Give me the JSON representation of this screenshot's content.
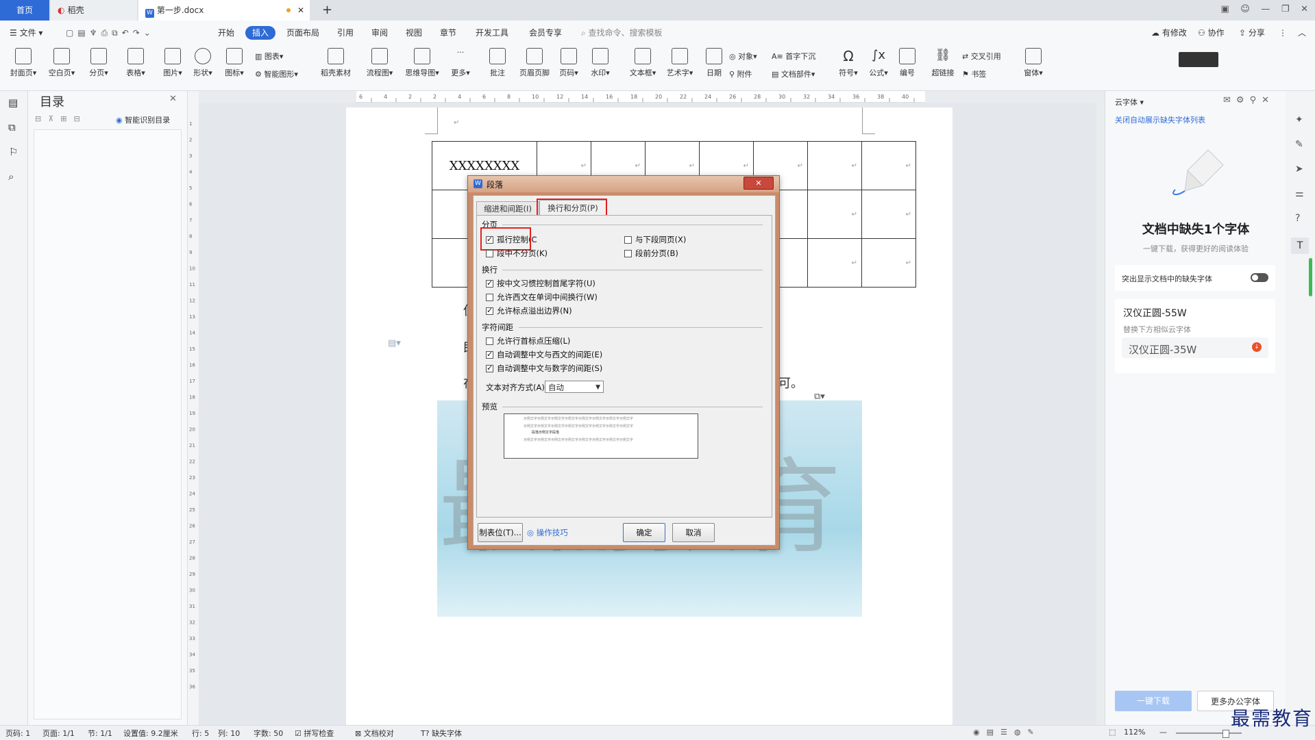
{
  "titlebar": {
    "tab_home": "首页",
    "tab_daoke": "稻壳",
    "tab_doc": "第一步.docx",
    "new_tab": "+"
  },
  "menubar": {
    "file": "文件",
    "items": [
      "开始",
      "插入",
      "页面布局",
      "引用",
      "审阅",
      "视图",
      "章节",
      "开发工具",
      "会员专享"
    ],
    "search_placeholder": "查找命令、搜索模板",
    "modify": "有修改",
    "collaborate": "协作",
    "share": "分享"
  },
  "ribbon": {
    "cover": "封面页",
    "blank": "空白页",
    "pagebreak": "分页",
    "table": "表格",
    "picture": "图片",
    "shape": "形状",
    "icon": "图标",
    "chart": "图表",
    "smartart": "智能图形",
    "daoke_material": "稻壳素材",
    "flowchart": "流程图",
    "mindmap": "思维导图",
    "more": "更多",
    "comment": "批注",
    "header_footer": "页眉页脚",
    "page_number": "页码",
    "watermark": "水印",
    "textbox": "文本框",
    "wordart": "艺术字",
    "date": "日期",
    "object": "对象",
    "attachment": "附件",
    "dropcap": "首字下沉",
    "docpart": "文档部件",
    "symbol": "符号",
    "formula": "公式",
    "numbering": "编号",
    "hyperlink": "超链接",
    "crossref": "交叉引用",
    "bookmark": "书签",
    "window": "窗体"
  },
  "navpanel": {
    "title": "目录",
    "smart_toc": "智能识别目录"
  },
  "document": {
    "table_first_cell": "XXXXXXXX",
    "para_mark": "↵",
    "text_fragment_1": "但",
    "text_fragment_2": "即",
    "text_fragment_3": "在",
    "text_fragment_end": "可。",
    "watermark_text": "最需教育"
  },
  "ruler": {
    "h_ticks": [
      "6",
      "4",
      "2",
      "2",
      "4",
      "6",
      "8",
      "10",
      "12",
      "14",
      "16",
      "18",
      "20",
      "22",
      "24",
      "26",
      "28",
      "30",
      "32",
      "34",
      "36",
      "38",
      "40"
    ],
    "v_ticks": [
      "1",
      "2",
      "3",
      "4",
      "5",
      "6",
      "7",
      "8",
      "9",
      "10",
      "11",
      "12",
      "13",
      "14",
      "15",
      "16",
      "17",
      "18",
      "19",
      "20",
      "21",
      "22",
      "23",
      "24",
      "25",
      "26",
      "27",
      "28",
      "29",
      "30",
      "31",
      "32",
      "33",
      "34",
      "35",
      "36"
    ]
  },
  "dialog": {
    "title": "段落",
    "tab_indent": "缩进和间距(I)",
    "tab_break": "换行和分页(P)",
    "sec_pagination": "分页",
    "widow_control": "孤行控制(C",
    "keep_with_next": "与下段同页(X)",
    "keep_lines": "段中不分页(K)",
    "page_break_before": "段前分页(B)",
    "sec_linebreak": "换行",
    "chinese_rules": "按中文习惯控制首尾字符(U)",
    "allow_word_wrap": "允许西文在单词中间换行(W)",
    "hanging_punct": "允许标点溢出边界(N)",
    "sec_spacing": "字符间距",
    "compress_punct": "允许行首标点压缩(L)",
    "auto_space_west": "自动调整中文与西文的间距(E)",
    "auto_space_num": "自动调整中文与数字的间距(S)",
    "text_align_label": "文本对齐方式(A):",
    "text_align_value": "自动",
    "sec_preview": "预览",
    "preview_sample": "示例文字示例文字示例文字示例文字示例文字示例文字示例文字示例文字",
    "preview_mid": "段落示例文字段落",
    "tabs_button": "制表位(T)...",
    "tips": "操作技巧",
    "ok": "确定",
    "cancel": "取消",
    "close": "✕"
  },
  "rightpanel": {
    "title": "云字体",
    "close_link": "关闭自动展示缺失字体列表",
    "missing_title": "文档中缺失1个字体",
    "missing_sub": "一键下载，获得更好的阅读体验",
    "highlight_label": "突出显示文档中的缺失字体",
    "font_name": "汉仪正圆-55W",
    "replace_hint": "替换下方相似云字体",
    "alt_font": "汉仪正圆-35W",
    "download_btn": "一键下载",
    "more_fonts": "更多办公字体"
  },
  "statusbar": {
    "page": "页码: 1",
    "pages": "页面: 1/1",
    "section": "节: 1/1",
    "setting": "设置值: 9.2厘米",
    "row": "行: 5",
    "col": "列: 10",
    "words": "字数: 50",
    "spellcheck": "拼写检查",
    "proofread": "文档校对",
    "missing_font": "缺失字体",
    "zoom": "112%",
    "brand": "最需教育"
  },
  "colors": {
    "accent": "#2f6bd6",
    "highlight_red": "#e02020"
  }
}
